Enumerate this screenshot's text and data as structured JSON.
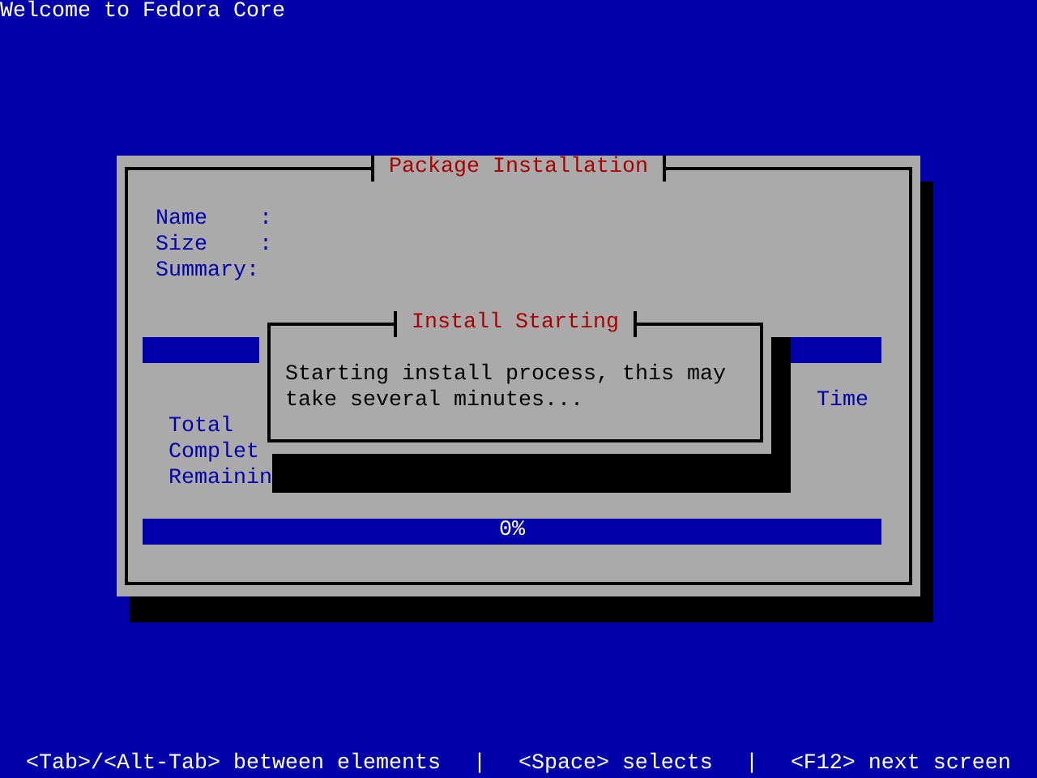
{
  "screen": {
    "title": "Welcome to Fedora Core"
  },
  "window": {
    "title": "Package Installation",
    "fields": [
      {
        "label": "Name    :"
      },
      {
        "label": "Size    :"
      },
      {
        "label": "Summary:"
      }
    ],
    "package_progress": {
      "level": 0
    },
    "stats_header": "Time",
    "stats": [
      {
        "label": "Total"
      },
      {
        "label": "Complet"
      },
      {
        "label": "Remainin"
      }
    ],
    "overall_progress": {
      "level": 0,
      "reading": "0%"
    }
  },
  "dialog": {
    "title": "Install Starting",
    "message": "Starting install process, this may take several minutes..."
  },
  "status_bar": [
    "<Tab>/<Alt-Tab> between elements",
    "|",
    "<Space> selects",
    "|",
    "<F12> next screen"
  ]
}
